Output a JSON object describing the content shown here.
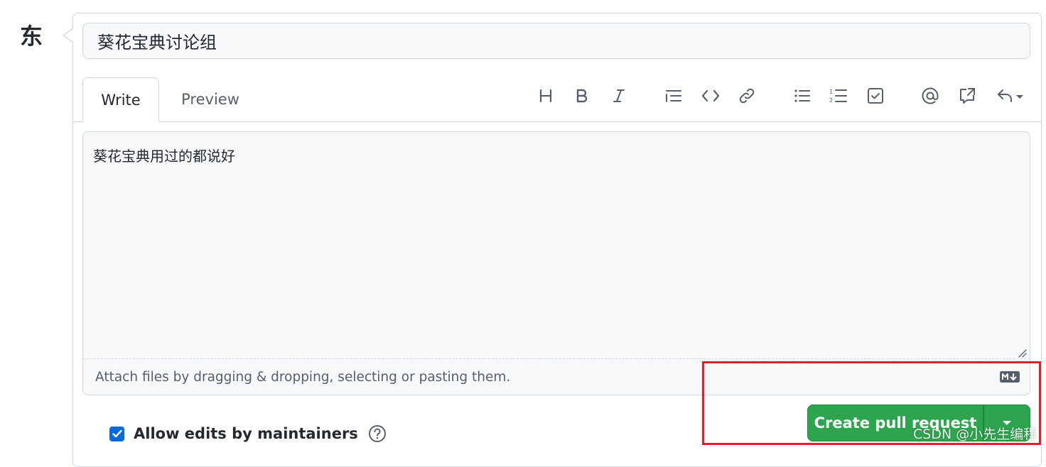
{
  "author": {
    "avatar_char": "东"
  },
  "title_input": {
    "value": "葵花宝典讨论组"
  },
  "tabs": [
    {
      "label": "Write",
      "active": true
    },
    {
      "label": "Preview",
      "active": false
    }
  ],
  "toolbar": {
    "icons": [
      "heading-icon",
      "bold-icon",
      "italic-icon",
      "quote-icon",
      "code-icon",
      "link-icon",
      "bulleted-list-icon",
      "numbered-list-icon",
      "task-list-icon",
      "mention-icon",
      "reference-icon",
      "reply-icon"
    ]
  },
  "editor": {
    "body": "葵花宝典用过的都说好",
    "attach_hint": "Attach files by dragging & dropping, selecting or pasting them."
  },
  "options": {
    "allow_edits_label": "Allow edits by maintainers",
    "allow_edits_checked": true
  },
  "actions": {
    "create_label": "Create pull request"
  },
  "watermark": "CSDN @小先生编程",
  "colors": {
    "primary_green": "#2da44e",
    "checkbox_blue": "#0969da",
    "highlight_red": "#e0202a"
  }
}
